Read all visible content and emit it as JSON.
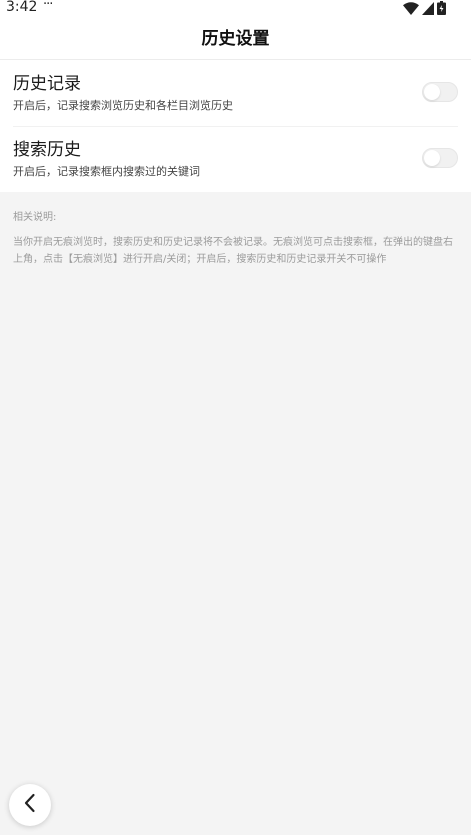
{
  "status_bar": {
    "time": "3:42",
    "dots": "···",
    "icons": [
      "wifi-icon",
      "signal-icon",
      "battery-icon"
    ]
  },
  "header": {
    "title": "历史设置"
  },
  "settings": [
    {
      "title": "历史记录",
      "description": "开启后，记录搜索浏览历史和各栏目浏览历史",
      "enabled": false
    },
    {
      "title": "搜索历史",
      "description": "开启后，记录搜索框内搜索过的关键词",
      "enabled": false
    }
  ],
  "notes": {
    "heading": "相关说明:",
    "body": "当你开启无痕浏览时，搜索历史和历史记录将不会被记录。无痕浏览可点击搜索框，在弹出的键盘右上角，点击【无痕浏览】进行开启/关闭；开启后，搜索历史和历史记录开关不可操作"
  },
  "nav": {
    "back_icon": "chevron-left-icon"
  },
  "colors": {
    "background": "#f4f4f4",
    "card": "#ffffff",
    "toggle_off": "#f1f1f1",
    "note_text": "#9b9b9b"
  }
}
